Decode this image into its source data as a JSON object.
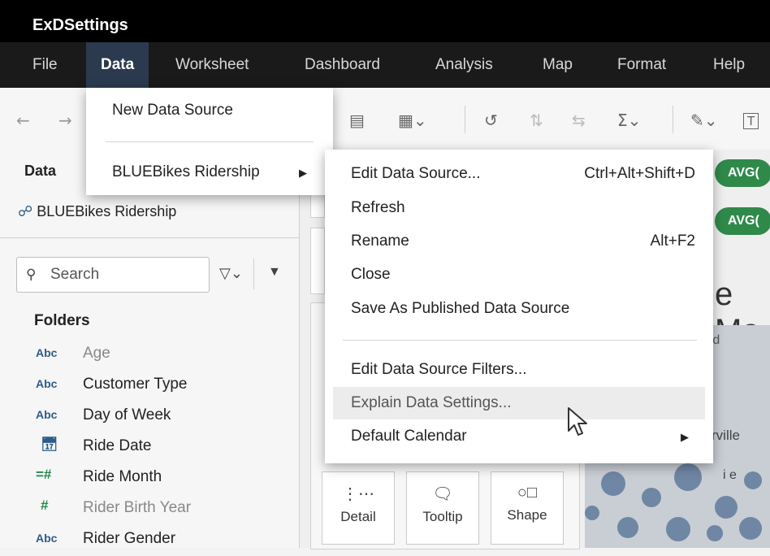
{
  "app_title": "ExDSettings",
  "menubar": [
    "File",
    "Data",
    "Worksheet",
    "Dashboard",
    "Analysis",
    "Map",
    "Format",
    "Help"
  ],
  "toolbar": {
    "back_icon": "arrow-left-icon",
    "forward_icon": "arrow-right-icon"
  },
  "data_pane": {
    "tab_label": "Data",
    "datasource": "BLUEBikes Ridership",
    "search_placeholder": "Search",
    "folders_label": "Folders",
    "fields": [
      {
        "type": "Abc",
        "name": "Age",
        "dim": true
      },
      {
        "type": "Abc",
        "name": "Customer Type",
        "dim": false
      },
      {
        "type": "Abc",
        "name": "Day of Week",
        "dim": false
      },
      {
        "type": "date",
        "name": "Ride Date",
        "dim": false
      },
      {
        "type": "=#",
        "name": "Ride Month",
        "dim": false
      },
      {
        "type": "#",
        "name": "Rider Birth Year",
        "dim": true
      },
      {
        "type": "Abc",
        "name": "Rider Gender",
        "dim": false
      }
    ]
  },
  "data_menu": {
    "items": [
      "New Data Source",
      "BLUEBikes Ridership"
    ]
  },
  "submenu": {
    "items": [
      {
        "label": "Edit Data Source...",
        "shortcut": "Ctrl+Alt+Shift+D"
      },
      {
        "label": "Refresh",
        "shortcut": ""
      },
      {
        "label": "Rename",
        "shortcut": "Alt+F2"
      },
      {
        "label": "Close",
        "shortcut": ""
      },
      {
        "label": "Save As Published Data Source",
        "shortcut": ""
      },
      {
        "label": "Edit Data Source Filters...",
        "shortcut": ""
      },
      {
        "label": "Explain Data Settings...",
        "shortcut": ""
      },
      {
        "label": "Default Calendar",
        "shortcut": ""
      }
    ]
  },
  "center": {
    "pill_1": "AVG(",
    "pill_2": "AVG(",
    "map_title_fragment": "e Ma",
    "map_labels": [
      "rd",
      "rville",
      "i e"
    ],
    "marks": [
      "Detail",
      "Tooltip",
      "Shape"
    ]
  },
  "colors": {
    "menubar_active": "#2b3a4f",
    "pill": "#2f8a4a",
    "field_type": "#2e5c8a",
    "measure": "#1f8a4c"
  }
}
